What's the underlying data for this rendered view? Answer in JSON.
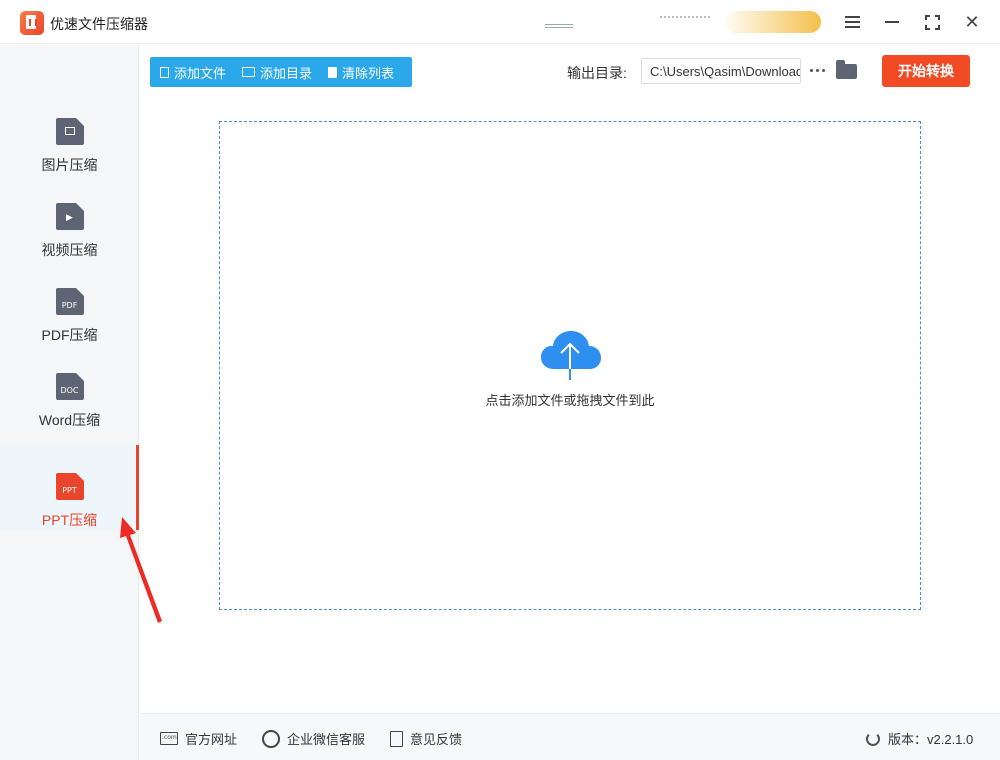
{
  "app": {
    "title": "优速文件压缩器"
  },
  "window": {
    "menu_icon": "menu-icon",
    "minimize_icon": "minimize-icon",
    "maximize_icon": "maximize-icon",
    "close_icon": "close-icon",
    "close_glyph": "✕"
  },
  "sidebar": {
    "items": [
      {
        "label": "图片压缩",
        "icon": "image-file-icon",
        "badge": ""
      },
      {
        "label": "视频压缩",
        "icon": "video-file-icon",
        "badge": "▶"
      },
      {
        "label": "PDF压缩",
        "icon": "pdf-file-icon",
        "badge": "PDF"
      },
      {
        "label": "Word压缩",
        "icon": "doc-file-icon",
        "badge": "DOC"
      },
      {
        "label": "PPT压缩",
        "icon": "ppt-file-icon",
        "badge": "PPT",
        "active": true
      }
    ]
  },
  "toolbar": {
    "add_file": "添加文件",
    "add_folder": "添加目录",
    "clear_list": "清除列表",
    "output_label": "输出目录:",
    "output_path": "C:\\Users\\Qasim\\Downloads",
    "start": "开始转换"
  },
  "dropzone": {
    "text": "点击添加文件或拖拽文件到此"
  },
  "footer": {
    "website": "官方网址",
    "wechat_service": "企业微信客服",
    "feedback": "意见反馈",
    "version": "版本：v2.2.1.0"
  },
  "colors": {
    "accent": "#2aa8ea",
    "primary_action": "#f04b24",
    "active": "#e8452c",
    "icon_gray": "#5d6575"
  }
}
